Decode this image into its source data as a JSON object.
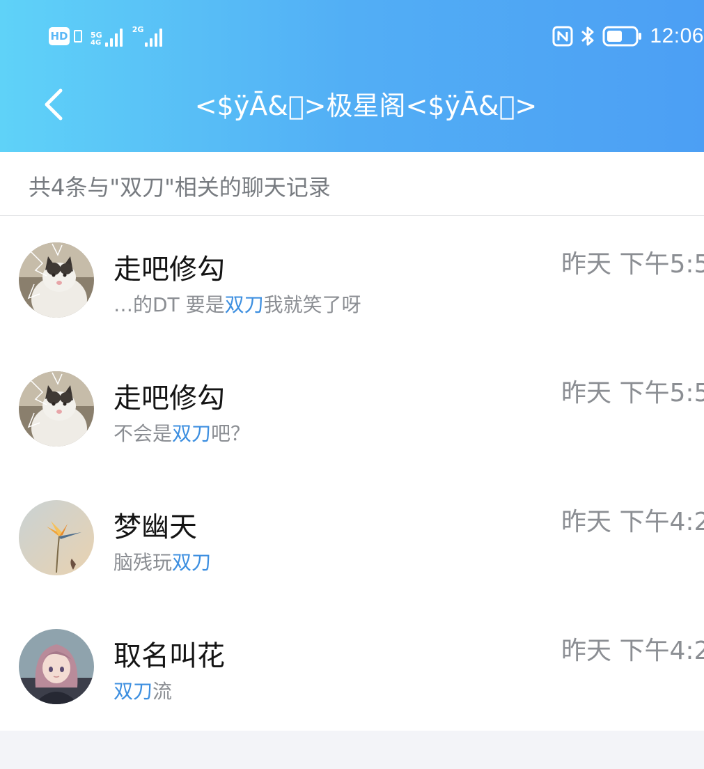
{
  "status_bar": {
    "hd_label": "HD",
    "signal_1_label": "5G",
    "signal_1_sublabel": "4G",
    "signal_2_label": "2G",
    "time": "12:06",
    "icons": [
      "nfc-icon",
      "bluetooth-icon",
      "battery-icon"
    ],
    "battery_level": 0.45
  },
  "header": {
    "title": "<$ÿĀ&\u0000>极星阁<$ÿĀ&\u0000>",
    "back_icon": "chevron-left-icon"
  },
  "summary": {
    "text": "共4条与\"双刀\"相关的聊天记录"
  },
  "results": [
    {
      "name": "走吧修勾",
      "snippet_before": "…的DT 要是",
      "snippet_highlight": "双刀",
      "snippet_after": "我就笑了呀",
      "time": "昨天 下午5:5",
      "avatar": "cat-avatar"
    },
    {
      "name": "走吧修勾",
      "snippet_before": "不会是",
      "snippet_highlight": "双刀",
      "snippet_after": "吧？",
      "time": "昨天 下午5:5",
      "avatar": "cat-avatar"
    },
    {
      "name": "梦幽天",
      "snippet_before": "脑残玩",
      "snippet_highlight": "双刀",
      "snippet_after": "",
      "time": "昨天 下午4:2",
      "avatar": "bird-of-paradise-avatar"
    },
    {
      "name": "取名叫花",
      "snippet_before": "",
      "snippet_highlight": "双刀",
      "snippet_after": "流",
      "time": "昨天 下午4:2",
      "avatar": "anime-girl-avatar"
    }
  ],
  "colors": {
    "header_gradient_start": "#5fd2f8",
    "header_gradient_end": "#4c9ff4",
    "highlight": "#3d8fe0",
    "secondary_text": "#8b8e93"
  }
}
